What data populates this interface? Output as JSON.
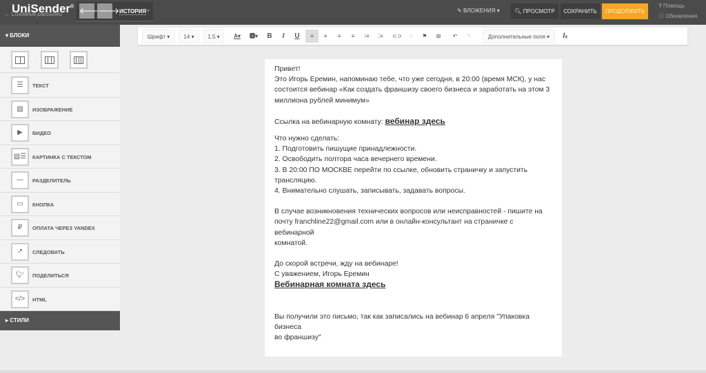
{
  "header": {
    "logo": "UniSender",
    "logo_mark": "®",
    "subtitle": "← Создание рассылки",
    "history": "ИСТОРИЯ",
    "attachments": "ВЛОЖЕНИЯ",
    "preview": "ПРОСМОТР",
    "save": "СОХРАНИТЬ",
    "continue": "ПРОДОЛЖИТЬ",
    "help": "Помощь",
    "updates": "Обновления",
    "accent": "#f5a623"
  },
  "sidebar": {
    "blocks_title": "БЛОКИ",
    "styles_title": "СТИЛИ",
    "items": [
      {
        "label": "ТЕКСТ",
        "icon": "text-icon"
      },
      {
        "label": "ИЗОБРАЖЕНИЕ",
        "icon": "image-icon"
      },
      {
        "label": "ВИДЕО",
        "icon": "video-icon"
      },
      {
        "label": "КАРТИНКА С ТЕКСТОМ",
        "icon": "image-text-icon"
      },
      {
        "label": "РАЗДЕЛИТЕЛЬ",
        "icon": "divider-icon"
      },
      {
        "label": "КНОПКА",
        "icon": "button-icon"
      },
      {
        "label": "ОПЛАТА ЧЕРЕЗ YANDEX",
        "icon": "payment-icon"
      },
      {
        "label": "СЛЕДОВАТЬ",
        "icon": "follow-icon"
      },
      {
        "label": "ПОДЕЛИТЬСЯ",
        "icon": "twitter-icon"
      },
      {
        "label": "HTML",
        "icon": "code-icon"
      }
    ]
  },
  "toolbar": {
    "font": "Шрифт",
    "size": "14",
    "line_height": "1.5",
    "extra_fields": "Дополнительные поля"
  },
  "email": {
    "greeting": "Привет!",
    "intro": [
      "Это Игорь Еремин, напоминаю тебе, что уже сегодня, в 20:00 (время МСК), у нас",
      "состоится вебинар «Как создать франшизу своего бизнеса и заработать на этом 3",
      "миллиона рублей минимум»"
    ],
    "link_prefix": "Ссылка на вебинарную комнату: ",
    "link_text": "вебинар здесь",
    "todo_title": "Что нужно сделать:",
    "todo": [
      "1. Подготовить пишущие принадлежности.",
      "2. Освободить полтора часа вечернего времени.",
      "3. В 20:00 ПО МОСКВЕ перейти по ссылке, обновить страничку и запустить",
      "трансляцию.",
      "4. Внимательно слушать, записывать, задавать вопросы."
    ],
    "support": [
      "В случае возникновения технических вопросов или неисправностей - пишите на",
      "почту franchline22@gmail.com или в онлайн-консультант на страничке с вебинарной",
      "комнатой."
    ],
    "closing": "До скорой встречи, жду на вебинаре!",
    "signature": "С уважением, Игорь Еремин",
    "room_link": "Вебинарная комната здесь",
    "footer": [
      "Вы получили это письмо, так как записались на вебинар 6 апреля \"Упаковка бизнеса",
      "во франшизу\""
    ]
  }
}
